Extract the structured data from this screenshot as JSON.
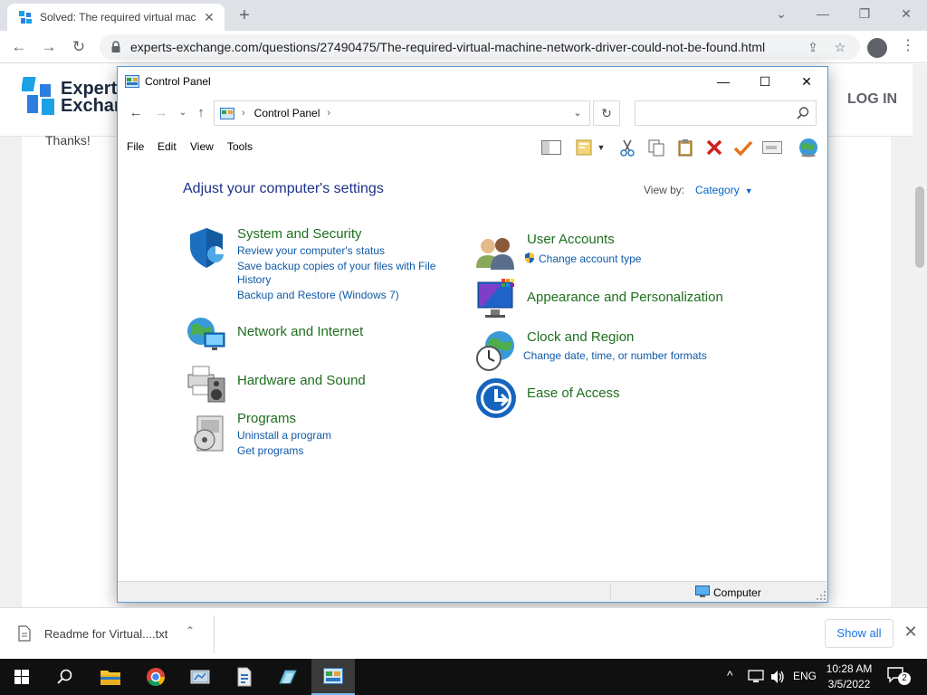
{
  "browser": {
    "tab_title": "Solved: The required virtual mac",
    "url": "experts-exchange.com/questions/27490475/The-required-virtual-machine-network-driver-could-not-be-found.html"
  },
  "page": {
    "logo_line1": "Expert",
    "logo_line2": "Exchar",
    "login": "LOG IN",
    "thanks": "Thanks!"
  },
  "control_panel": {
    "window_title": "Control Panel",
    "breadcrumb": "Control Panel",
    "menu": [
      "File",
      "Edit",
      "View",
      "Tools"
    ],
    "heading": "Adjust your computer's settings",
    "view_by_label": "View by:",
    "view_by_value": "Category",
    "categories": [
      {
        "title": "System and Security",
        "links": [
          "Review your computer's status",
          "Save backup copies of your files with File History",
          "Backup and Restore (Windows 7)"
        ]
      },
      {
        "title": "Network and Internet",
        "links": []
      },
      {
        "title": "Hardware and Sound",
        "links": []
      },
      {
        "title": "Programs",
        "links": [
          "Uninstall a program",
          "Get programs"
        ]
      },
      {
        "title": "User Accounts",
        "links": [
          "Change account type"
        ]
      },
      {
        "title": "Appearance and Personalization",
        "links": []
      },
      {
        "title": "Clock and Region",
        "links": [
          "Change date, time, or number formats"
        ]
      },
      {
        "title": "Ease of Access",
        "links": []
      }
    ],
    "status": "Computer"
  },
  "downloads": {
    "file_name": "Readme for Virtual....txt",
    "show_all": "Show all"
  },
  "taskbar": {
    "language": "ENG",
    "time": "10:28 AM",
    "date": "3/5/2022",
    "notification_count": "2"
  },
  "colors": {
    "category_title": "#1e6e1e",
    "link": "#0f5aa8",
    "heading": "#1e3287",
    "taskbar": "#101010"
  }
}
